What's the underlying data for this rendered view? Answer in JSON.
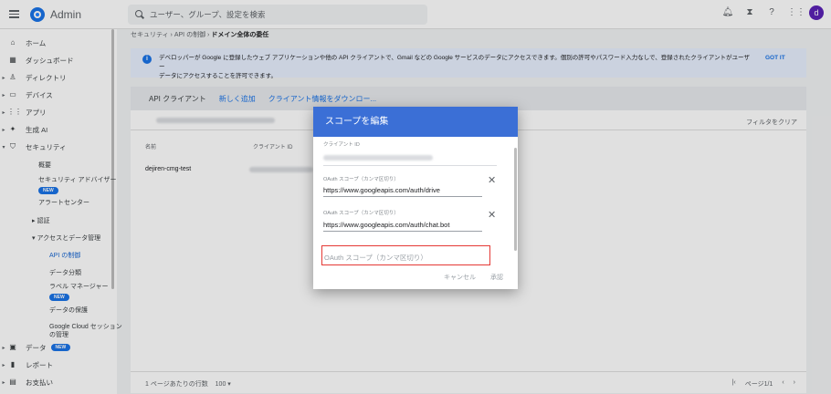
{
  "topbar": {
    "title": "Admin",
    "search_placeholder": "ユーザー、グループ、設定を検索",
    "avatar_letter": "d",
    "icons": [
      "bell-icon",
      "hourglass-icon",
      "help-icon",
      "apps-icon"
    ]
  },
  "sidebar": {
    "items": [
      {
        "label": "ホーム",
        "icon": "home-icon",
        "glyph": "⌂"
      },
      {
        "label": "ダッシュボード",
        "icon": "dashboard-icon",
        "glyph": "▦"
      },
      {
        "label": "ディレクトリ",
        "icon": "person-icon",
        "glyph": "♙"
      },
      {
        "label": "デバイス",
        "icon": "devices-icon",
        "glyph": "▭"
      },
      {
        "label": "アプリ",
        "icon": "apps-grid-icon",
        "glyph": "⋮⋮"
      },
      {
        "label": "生成 AI",
        "icon": "sparkle-icon",
        "glyph": "✦"
      },
      {
        "label": "セキュリティ",
        "icon": "shield-icon",
        "glyph": "⛉"
      }
    ],
    "security_sub": {
      "overview": "概要",
      "advisor": "セキュリティ アドバイザー",
      "alert_center": "アラートセンター",
      "auth": "認証",
      "access_data": "アクセスとデータ管理",
      "api_controls": "API の制御",
      "data_class": "データ分類",
      "label_manager": "ラベル マネージャー",
      "data_protection": "データの保護",
      "gcloud_session_1": "Google Cloud セッション",
      "gcloud_session_2": "の管理"
    },
    "bottom": [
      {
        "label": "データ",
        "icon": "data-icon",
        "glyph": "▣"
      },
      {
        "label": "レポート",
        "icon": "reports-icon",
        "glyph": "▮"
      },
      {
        "label": "お支払い",
        "icon": "billing-icon",
        "glyph": "▤"
      }
    ],
    "new_badge": "NEW"
  },
  "breadcrumb": {
    "part1": "セキュリティ",
    "part2": "API の制御",
    "current": "ドメイン全体の委任",
    "sep": "›"
  },
  "info": {
    "line1": "デベロッパーが Google に登録したウェブ アプリケーションや他の API クライアントで、Gmail などの Google サービスのデータにアクセスできます。個別の許可やパスワード入力なしで、登録されたクライアントがユーザー",
    "line2": "データにアクセスすることを許可できます。",
    "gotit": "GOT IT"
  },
  "card": {
    "tab_api": "API クライアント",
    "tab_add": "新しく追加",
    "tab_download": "クライアント情報をダウンロー...",
    "filter_clear": "フィルタをクリア",
    "col_name": "名前",
    "col_client_id": "クライアント ID",
    "row_name": "dejiren-cmg-test",
    "rows_per_page": "1 ページあたりの行数",
    "rows_value": "100",
    "page_info": "ページ1/1"
  },
  "dialog": {
    "title": "スコープを編集",
    "client_id_label": "クライアント ID",
    "scope_label_1": "OAuth スコープ（カンマ区切り）",
    "scope_value_1": "https://www.googleapis.com/auth/drive",
    "scope_label_2": "OAuth スコープ（カンマ区切り）",
    "scope_value_2": "https://www.googleapis.com/auth/chat.bot",
    "scope_placeholder": "OAuth スコープ（カンマ区切り）",
    "cancel": "キャンセル",
    "authorize": "承認"
  },
  "colors": {
    "accent": "#1a73e8",
    "dialog_header": "#3b6fd6",
    "highlight": "#e53935",
    "avatar": "#5b21b6"
  }
}
